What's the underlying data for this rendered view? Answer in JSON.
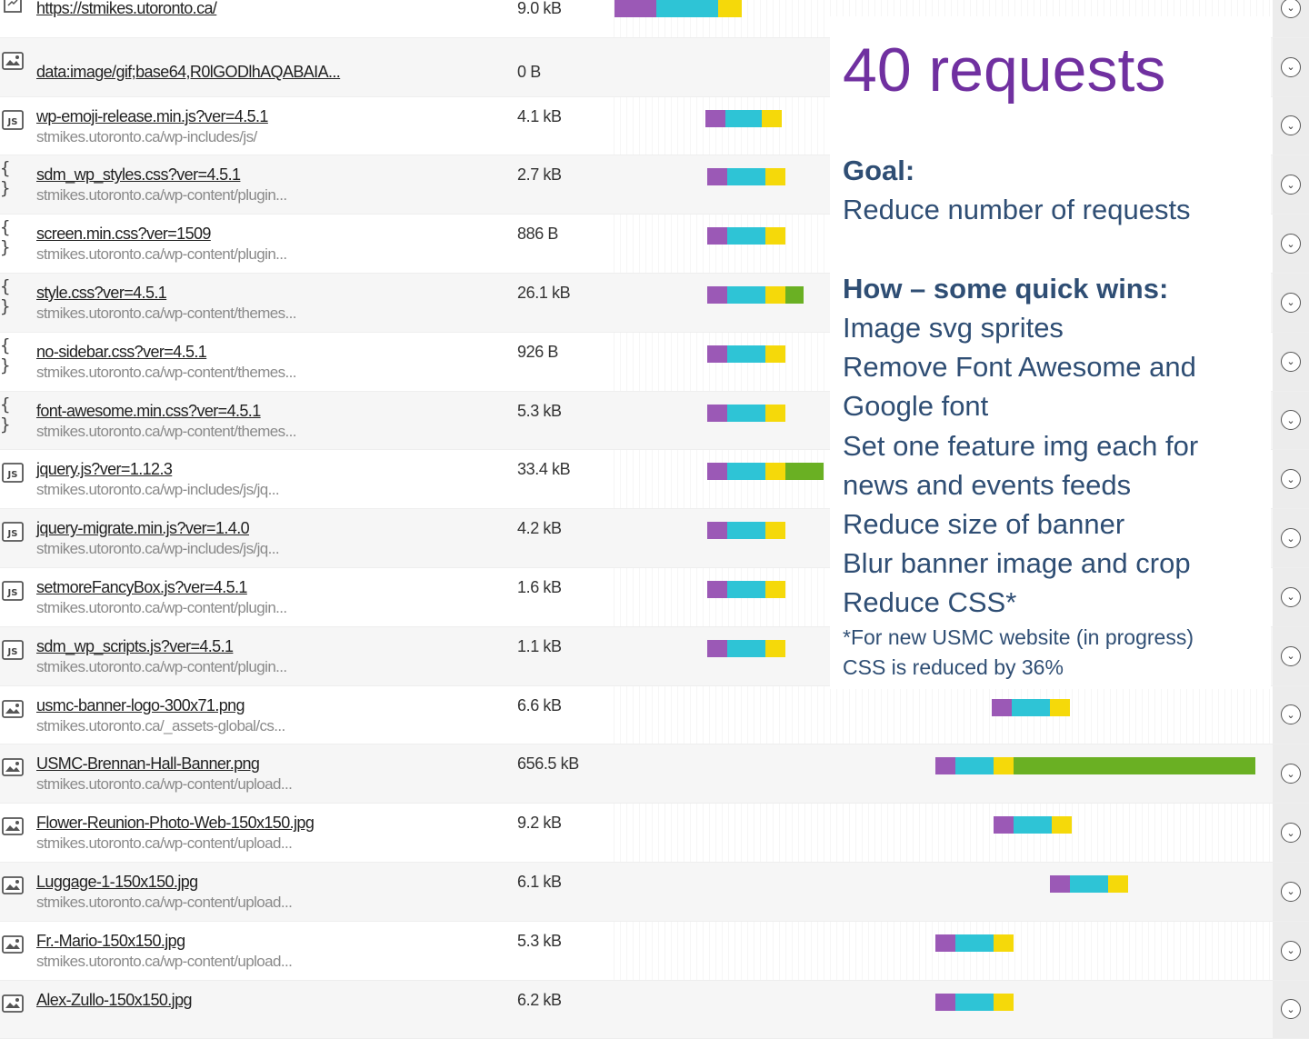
{
  "requests": [
    {
      "icon": "page",
      "name": "https://stmikes.utoronto.ca/",
      "host": "",
      "size": "9.0 kB",
      "bar": {
        "start": 676,
        "segments": [
          {
            "color": "#9b59b6",
            "w": 46
          },
          {
            "color": "#2ec4d6",
            "w": 68
          },
          {
            "color": "#f5d90a",
            "w": 26
          }
        ]
      }
    },
    {
      "icon": "image",
      "name": "data:image/gif;base64,R0lGODlhAQABAIA...",
      "host": "",
      "size": "0 B",
      "bar": null
    },
    {
      "icon": "js",
      "name": "wp-emoji-release.min.js?ver=4.5.1",
      "host": "stmikes.utoronto.ca/wp-includes/js/",
      "size": "4.1 kB",
      "bar": {
        "start": 776,
        "segments": [
          {
            "color": "#9b59b6",
            "w": 22
          },
          {
            "color": "#2ec4d6",
            "w": 40
          },
          {
            "color": "#f5d90a",
            "w": 22
          }
        ]
      }
    },
    {
      "icon": "css",
      "name": "sdm_wp_styles.css?ver=4.5.1",
      "host": "stmikes.utoronto.ca/wp-content/plugin...",
      "size": "2.7 kB",
      "bar": {
        "start": 778,
        "segments": [
          {
            "color": "#9b59b6",
            "w": 22
          },
          {
            "color": "#2ec4d6",
            "w": 42
          },
          {
            "color": "#f5d90a",
            "w": 22
          }
        ]
      }
    },
    {
      "icon": "css",
      "name": "screen.min.css?ver=1509",
      "host": "stmikes.utoronto.ca/wp-content/plugin...",
      "size": "886 B",
      "bar": {
        "start": 778,
        "segments": [
          {
            "color": "#9b59b6",
            "w": 22
          },
          {
            "color": "#2ec4d6",
            "w": 42
          },
          {
            "color": "#f5d90a",
            "w": 22
          }
        ]
      }
    },
    {
      "icon": "css",
      "name": "style.css?ver=4.5.1",
      "host": "stmikes.utoronto.ca/wp-content/themes...",
      "size": "26.1 kB",
      "bar": {
        "start": 778,
        "segments": [
          {
            "color": "#9b59b6",
            "w": 22
          },
          {
            "color": "#2ec4d6",
            "w": 42
          },
          {
            "color": "#f5d90a",
            "w": 22
          },
          {
            "color": "#6ab023",
            "w": 20
          }
        ]
      }
    },
    {
      "icon": "css",
      "name": "no-sidebar.css?ver=4.5.1",
      "host": "stmikes.utoronto.ca/wp-content/themes...",
      "size": "926 B",
      "bar": {
        "start": 778,
        "segments": [
          {
            "color": "#9b59b6",
            "w": 22
          },
          {
            "color": "#2ec4d6",
            "w": 42
          },
          {
            "color": "#f5d90a",
            "w": 22
          }
        ]
      }
    },
    {
      "icon": "css",
      "name": "font-awesome.min.css?ver=4.5.1",
      "host": "stmikes.utoronto.ca/wp-content/themes...",
      "size": "5.3 kB",
      "bar": {
        "start": 778,
        "segments": [
          {
            "color": "#9b59b6",
            "w": 22
          },
          {
            "color": "#2ec4d6",
            "w": 42
          },
          {
            "color": "#f5d90a",
            "w": 22
          }
        ]
      }
    },
    {
      "icon": "js",
      "name": "jquery.js?ver=1.12.3",
      "host": "stmikes.utoronto.ca/wp-includes/js/jq...",
      "size": "33.4 kB",
      "bar": {
        "start": 778,
        "segments": [
          {
            "color": "#9b59b6",
            "w": 22
          },
          {
            "color": "#2ec4d6",
            "w": 42
          },
          {
            "color": "#f5d90a",
            "w": 22
          },
          {
            "color": "#6ab023",
            "w": 42
          }
        ]
      }
    },
    {
      "icon": "js",
      "name": "jquery-migrate.min.js?ver=1.4.0",
      "host": "stmikes.utoronto.ca/wp-includes/js/jq...",
      "size": "4.2 kB",
      "bar": {
        "start": 778,
        "segments": [
          {
            "color": "#9b59b6",
            "w": 22
          },
          {
            "color": "#2ec4d6",
            "w": 42
          },
          {
            "color": "#f5d90a",
            "w": 22
          }
        ]
      }
    },
    {
      "icon": "js",
      "name": "setmoreFancyBox.js?ver=4.5.1",
      "host": "stmikes.utoronto.ca/wp-content/plugin...",
      "size": "1.6 kB",
      "bar": {
        "start": 778,
        "segments": [
          {
            "color": "#9b59b6",
            "w": 22
          },
          {
            "color": "#2ec4d6",
            "w": 42
          },
          {
            "color": "#f5d90a",
            "w": 22
          }
        ]
      }
    },
    {
      "icon": "js",
      "name": "sdm_wp_scripts.js?ver=4.5.1",
      "host": "stmikes.utoronto.ca/wp-content/plugin...",
      "size": "1.1 kB",
      "bar": {
        "start": 778,
        "segments": [
          {
            "color": "#9b59b6",
            "w": 22
          },
          {
            "color": "#2ec4d6",
            "w": 42
          },
          {
            "color": "#f5d90a",
            "w": 22
          }
        ]
      }
    },
    {
      "icon": "image",
      "name": "usmc-banner-logo-300x71.png",
      "host": "stmikes.utoronto.ca/_assets-global/cs...",
      "size": "6.6 kB",
      "bar": {
        "start": 1091,
        "segments": [
          {
            "color": "#9b59b6",
            "w": 22
          },
          {
            "color": "#2ec4d6",
            "w": 42
          },
          {
            "color": "#f5d90a",
            "w": 22
          }
        ]
      }
    },
    {
      "icon": "image",
      "name": "USMC-Brennan-Hall-Banner.png",
      "host": "stmikes.utoronto.ca/wp-content/upload...",
      "size": "656.5 kB",
      "bar": {
        "start": 1029,
        "segments": [
          {
            "color": "#9b59b6",
            "w": 22
          },
          {
            "color": "#2ec4d6",
            "w": 42
          },
          {
            "color": "#f5d90a",
            "w": 22
          },
          {
            "color": "#6ab023",
            "w": 266
          }
        ]
      }
    },
    {
      "icon": "image",
      "name": "Flower-Reunion-Photo-Web-150x150.jpg",
      "host": "stmikes.utoronto.ca/wp-content/upload...",
      "size": "9.2 kB",
      "bar": {
        "start": 1093,
        "segments": [
          {
            "color": "#9b59b6",
            "w": 22
          },
          {
            "color": "#2ec4d6",
            "w": 42
          },
          {
            "color": "#f5d90a",
            "w": 22
          }
        ]
      }
    },
    {
      "icon": "image",
      "name": "Luggage-1-150x150.jpg",
      "host": "stmikes.utoronto.ca/wp-content/upload...",
      "size": "6.1 kB",
      "bar": {
        "start": 1155,
        "segments": [
          {
            "color": "#9b59b6",
            "w": 22
          },
          {
            "color": "#2ec4d6",
            "w": 42
          },
          {
            "color": "#f5d90a",
            "w": 22
          }
        ]
      }
    },
    {
      "icon": "image",
      "name": "Fr.-Mario-150x150.jpg",
      "host": "stmikes.utoronto.ca/wp-content/upload...",
      "size": "5.3 kB",
      "bar": {
        "start": 1029,
        "segments": [
          {
            "color": "#9b59b6",
            "w": 22
          },
          {
            "color": "#2ec4d6",
            "w": 42
          },
          {
            "color": "#f5d90a",
            "w": 22
          }
        ]
      }
    },
    {
      "icon": "image",
      "name": "Alex-Zullo-150x150.jpg",
      "host": "",
      "size": "6.2 kB",
      "bar": {
        "start": 1029,
        "segments": [
          {
            "color": "#9b59b6",
            "w": 22
          },
          {
            "color": "#2ec4d6",
            "w": 42
          },
          {
            "color": "#f5d90a",
            "w": 22
          }
        ]
      }
    }
  ],
  "toggle_icon": "chevron-down-icon",
  "slide": {
    "title": "40 requests",
    "goal_heading": "Goal:",
    "goal_text": "Reduce number of requests",
    "how_heading": "How – some quick wins:",
    "items": [
      "Image svg sprites",
      "Remove Font Awesome and",
      "Google font",
      "Set one feature img each for",
      "news and events feeds",
      "Reduce size of banner",
      "Blur banner image and crop",
      "Reduce CSS*"
    ],
    "note_1": "*For new USMC website (in progress)",
    "note_2": "CSS is reduced by 36%"
  }
}
